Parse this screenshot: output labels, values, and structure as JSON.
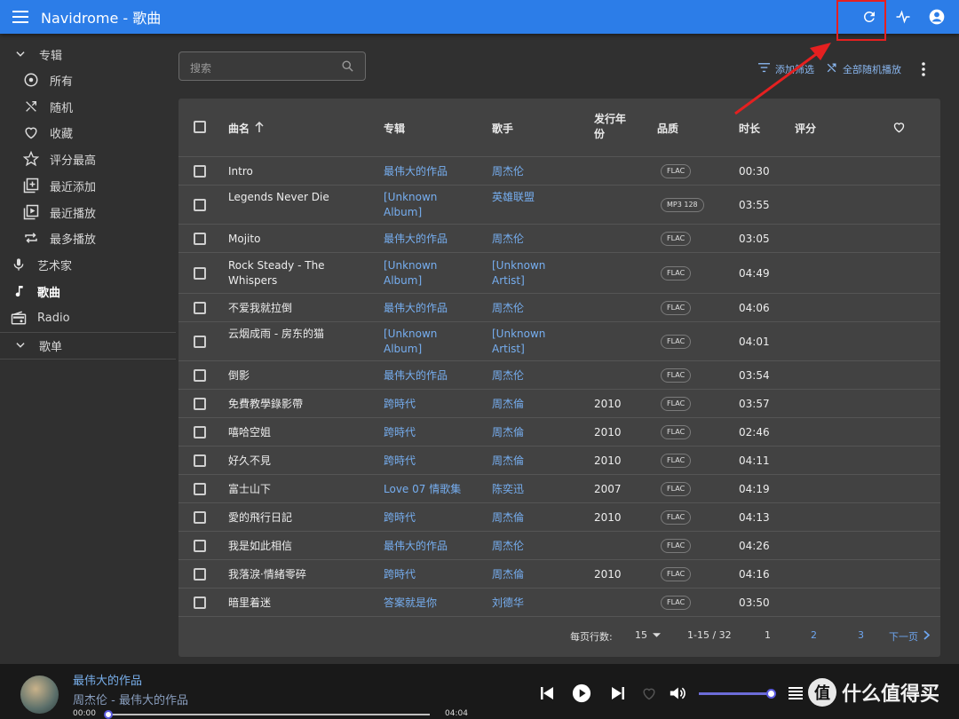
{
  "app": {
    "title": "Navidrome - 歌曲"
  },
  "sidebar": {
    "albums": "专辑",
    "album_items": [
      "所有",
      "随机",
      "收藏",
      "评分最高",
      "最近添加",
      "最近播放",
      "最多播放"
    ],
    "artists": "艺术家",
    "songs": "歌曲",
    "radio": "Radio",
    "playlists": "歌单"
  },
  "toolbar": {
    "search_placeholder": "搜索",
    "add_filter": "添加筛选",
    "shuffle_all": "全部随机播放"
  },
  "table": {
    "headers": [
      "曲名",
      "专辑",
      "歌手",
      "发行年份",
      "品质",
      "时长",
      "评分"
    ],
    "rows": [
      {
        "title": "Intro",
        "album": "最伟大的作品",
        "artist": "周杰伦",
        "year": "",
        "quality": "FLAC",
        "duration": "00:30"
      },
      {
        "title": "Legends Never Die",
        "album": "[Unknown Album]",
        "artist": "英雄联盟",
        "year": "",
        "quality": "MP3 128",
        "duration": "03:55"
      },
      {
        "title": "Mojito",
        "album": "最伟大的作品",
        "artist": "周杰伦",
        "year": "",
        "quality": "FLAC",
        "duration": "03:05"
      },
      {
        "title": "Rock Steady - The Whispers",
        "album": "[Unknown Album]",
        "artist": "[Unknown Artist]",
        "year": "",
        "quality": "FLAC",
        "duration": "04:49"
      },
      {
        "title": "不爱我就拉倒",
        "album": "最伟大的作品",
        "artist": "周杰伦",
        "year": "",
        "quality": "FLAC",
        "duration": "04:06"
      },
      {
        "title": "云烟成雨 - 房东的猫",
        "album": "[Unknown Album]",
        "artist": "[Unknown Artist]",
        "year": "",
        "quality": "FLAC",
        "duration": "04:01"
      },
      {
        "title": "倒影",
        "album": "最伟大的作品",
        "artist": "周杰伦",
        "year": "",
        "quality": "FLAC",
        "duration": "03:54"
      },
      {
        "title": "免費教學錄影帶",
        "album": "跨時代",
        "artist": "周杰倫",
        "year": "2010",
        "quality": "FLAC",
        "duration": "03:57"
      },
      {
        "title": "嘻哈空姐",
        "album": "跨時代",
        "artist": "周杰倫",
        "year": "2010",
        "quality": "FLAC",
        "duration": "02:46"
      },
      {
        "title": "好久不見",
        "album": "跨時代",
        "artist": "周杰倫",
        "year": "2010",
        "quality": "FLAC",
        "duration": "04:11"
      },
      {
        "title": "富士山下",
        "album": "Love 07 情歌集",
        "artist": "陈奕迅",
        "year": "2007",
        "quality": "FLAC",
        "duration": "04:19"
      },
      {
        "title": "愛的飛行日記",
        "album": "跨時代",
        "artist": "周杰倫",
        "year": "2010",
        "quality": "FLAC",
        "duration": "04:13"
      },
      {
        "title": "我是如此相信",
        "album": "最伟大的作品",
        "artist": "周杰伦",
        "year": "",
        "quality": "FLAC",
        "duration": "04:26"
      },
      {
        "title": "我落淚·情緒零碎",
        "album": "跨時代",
        "artist": "周杰倫",
        "year": "2010",
        "quality": "FLAC",
        "duration": "04:16"
      },
      {
        "title": "暗里着迷",
        "album": "答案就是你",
        "artist": "刘德华",
        "year": "",
        "quality": "FLAC",
        "duration": "03:50"
      }
    ],
    "footer": {
      "rows_per_page_label": "每页行数:",
      "rows_per_page": "15",
      "range": "1-15 / 32",
      "pages": [
        "1",
        "2",
        "3"
      ],
      "next": "下一页"
    }
  },
  "player": {
    "title": "最伟大的作品",
    "subtitle": "周杰伦 - 最伟大的作品",
    "current_time": "00:00",
    "total_time": "04:04",
    "progress": 0,
    "volume": 1.0
  },
  "watermark": {
    "logo": "值",
    "text": "什么值得买"
  },
  "colors": {
    "appbar": "#2c7de8",
    "link": "#76aef0",
    "annotation": "#e52020"
  }
}
